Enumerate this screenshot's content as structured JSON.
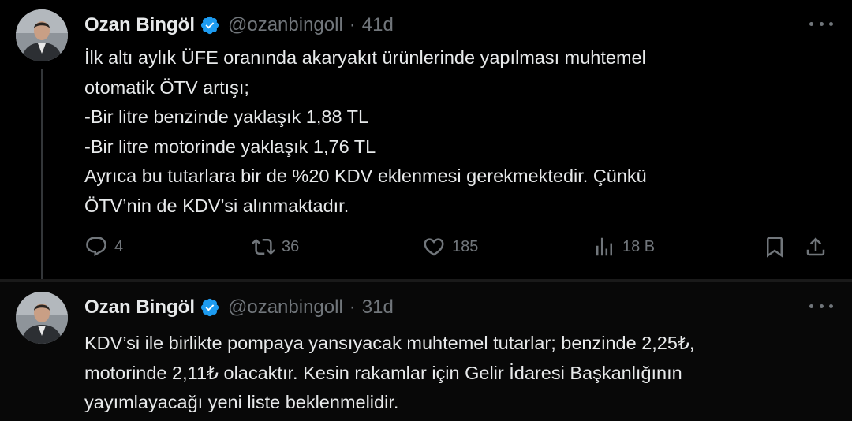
{
  "tweets": [
    {
      "author_name": "Ozan Bingöl",
      "handle": "@ozanbingoll",
      "separator": "·",
      "time": "41d",
      "lines": [
        "İlk altı aylık ÜFE oranında akaryakıt ürünlerinde yapılması muhtemel",
        "otomatik ÖTV artışı;",
        "-Bir litre benzinde yaklaşık 1,88 TL",
        "-Bir litre motorinde yaklaşık 1,76 TL",
        "Ayrıca bu tutarlara bir de %20 KDV eklenmesi gerekmektedir. Çünkü",
        "ÖTV’nin de KDV’si alınmaktadır."
      ],
      "actions": {
        "replies": "4",
        "reposts": "36",
        "likes": "185",
        "views": "18 B"
      }
    },
    {
      "author_name": "Ozan Bingöl",
      "handle": "@ozanbingoll",
      "separator": "·",
      "time": "31d",
      "lines": [
        "KDV’si ile birlikte pompaya yansıyacak muhtemel tutarlar; benzinde 2,25₺,",
        "motorinde 2,11₺ olacaktır. Kesin rakamlar için Gelir İdaresi Başkanlığının",
        "yayımlayacağı yeni liste beklenmelidir."
      ]
    }
  ],
  "icons": {
    "verified": "verified-badge-icon",
    "more": "more-options-icon",
    "reply": "reply-icon",
    "repost": "repost-icon",
    "like": "heart-icon",
    "views": "views-chart-icon",
    "bookmark": "bookmark-icon",
    "share": "share-icon"
  },
  "colors": {
    "background": "#000000",
    "text": "#e7e9ea",
    "muted": "#71767b",
    "verified": "#1d9bf0",
    "thread_line": "#333639"
  }
}
